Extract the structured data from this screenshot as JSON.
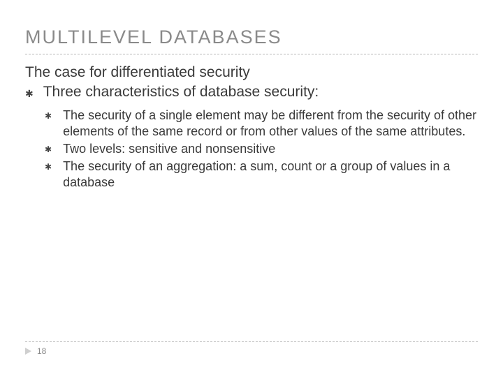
{
  "title": "MULTILEVEL DATABASES",
  "subtitle": "The case for differentiated security",
  "bullet_glyph": "✱",
  "main_point": "Three characteristics of database security:",
  "sub_points": [
    "The security of a single element may be different from the security of other elements of the same record or from other values of the same attributes.",
    "Two levels: sensitive and nonsensitive",
    "The security of an aggregation: a sum, count or a group of values in a database"
  ],
  "page_number": "18"
}
